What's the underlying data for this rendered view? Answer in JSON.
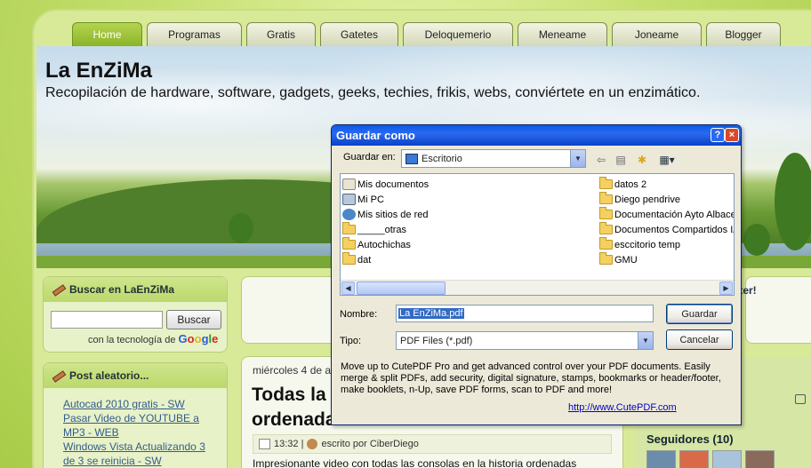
{
  "nav": {
    "tabs": [
      "Home",
      "Programas",
      "Gratis",
      "Gatetes",
      "Deloquemerio",
      "Meneame",
      "Joneame",
      "Blogger"
    ],
    "active_index": 0
  },
  "header": {
    "title": "La EnZiMa",
    "description": "Recopilación de hardware, software, gadgets, geeks, techies, frikis, webs, conviértete en un enzimático."
  },
  "search_widget": {
    "title": "Buscar en LaEnZiMa",
    "button": "Buscar",
    "powered_by": "con la tecnología de",
    "google_letters": [
      "G",
      "o",
      "o",
      "g",
      "l",
      "e"
    ]
  },
  "random_post_widget": {
    "title": "Post aleatorio...",
    "links": [
      "Autocad 2010 gratis - SW",
      "Pasar Video de YOUTUBE a",
      "MP3 - WEB",
      "Windows Vista Actualizando 3",
      "de 3 se reinicia - SW"
    ]
  },
  "post": {
    "date": "miércoles 4 de a",
    "title_line1": "Todas la",
    "title_line2": "ordenada",
    "time": "13:32 |",
    "author_text": "escrito por CiberDiego",
    "body": "Impresionante video con todas las consolas en la historia ordenadas"
  },
  "right_col": {
    "twitter_fragment": "itter!",
    "followers": "Seguidores (10)",
    "fragment_t": "t"
  },
  "dialog": {
    "title": "Guardar como",
    "help_glyph": "?",
    "close_glyph": "×",
    "save_in_label": "Guardar en:",
    "save_in_value": "Escritorio",
    "files_left": [
      "Mis documentos",
      "Mi PC",
      "Mis sitios de red",
      "_____otras",
      "Autochichas",
      "dat"
    ],
    "files_right": [
      "datos 2",
      "Diego pendrive",
      "Documentación Ayto Albace",
      "Documentos Compartidos IA",
      "esccitorio temp",
      "GMU"
    ],
    "filename_label": "Nombre:",
    "filename_value": "La EnZiMa.pdf",
    "type_label": "Tipo:",
    "type_value": "PDF Files (*.pdf)",
    "save_button": "Guardar",
    "cancel_button": "Cancelar",
    "promo_text": "Move up to CutePDF Pro and get advanced control over your PDF documents. Easily merge & split PDFs, add security, digital signature, stamps, bookmarks or header/footer, make booklets, n-Up, save PDF forms, scan to PDF and more!",
    "promo_link": "http://www.CutePDF.com"
  },
  "colors": {
    "xp_titlebar": "#0a5ae8",
    "active_tab": "#8cb428",
    "selection": "#316ac5"
  }
}
